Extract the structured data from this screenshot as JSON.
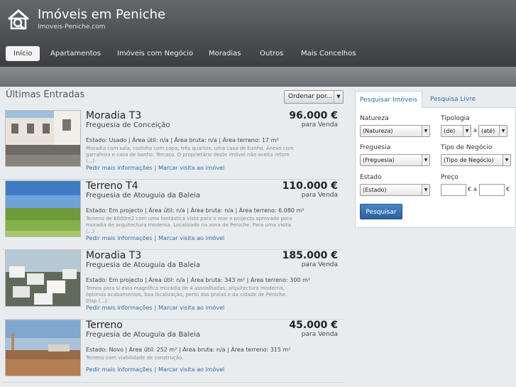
{
  "site": {
    "title": "Imóveis em Peniche",
    "subtitle": "Imoveis-Peniche.com",
    "logo_icon": "house-magnifier-icon"
  },
  "nav": {
    "items": [
      {
        "label": "Início",
        "active": true
      },
      {
        "label": "Apartamentos"
      },
      {
        "label": "Imóveis com Negócio"
      },
      {
        "label": "Moradias"
      },
      {
        "label": "Outros"
      },
      {
        "label": "Mais Concelhos"
      }
    ]
  },
  "listings_header": {
    "title": "Últimas Entradas",
    "order_label": "Ordenar por..."
  },
  "listings": [
    {
      "type": "Moradia  T3",
      "parish": "Freguesia de Conceição",
      "price": "96.000 €",
      "deal": "para Venda",
      "specs": "Estado: Usado  | Área útil: n/a  | Área bruta: n/a  | Área terreno: 17 m²",
      "description": "Moradia com sala, cozinha com copa, três quartos, uma casa de banho. Anexo com garrafeira e casa de banho. Terraço. O proprietário deste imóvel não aceita retom (...)",
      "link_info": "Pedir mais informações",
      "link_visit": "Marcar visita ao imóvel"
    },
    {
      "type": "Terreno  T4",
      "parish": "Freguesia de Atouguia da Baleia",
      "price": "110.000 €",
      "deal": "para Venda",
      "specs": "Estado: Em projecto  | Área útil: n/a  | Área bruta: n/a  | Área terreno: 6.080 m²",
      "description": "Terreno de 6000m2 com uma fantástica vista para o mar e projecto aprovado para moradia de arquitectura moderna. Localizado na zona de Peniche. Para uma visita (...)",
      "link_info": "Pedir mais informações",
      "link_visit": "Marcar visita ao imóvel"
    },
    {
      "type": "Moradia  T3",
      "parish": "Freguesia de Atouguia da Baleia",
      "price": "185.000 €",
      "deal": "para Venda",
      "specs": "Estado: Em projecto  | Área útil: n/a  | Área bruta: 343 m²  | Área terreno: 300 m²",
      "description": "Temos para si esta magnífica moradia de 4 assoalhadas, arquitectura moderna, óptimos acabamentos, boa localização, perto das praias e da cidade de Peniche. Disp (...)",
      "link_info": "Pedir mais informações",
      "link_visit": "Marcar visita ao imóvel"
    },
    {
      "type": "Terreno",
      "parish": "Freguesia de Atouguia da Baleia",
      "price": "45.000 €",
      "deal": "para Venda",
      "specs": "Estado: Novo  | Área útil: 252 m²  | Área bruta: n/a  | Área terreno: 315 m²",
      "description": "Terreno com viabilidade de construção.",
      "link_info": "Pedir mais informações",
      "link_visit": "Marcar visita ao imóvel"
    }
  ],
  "search": {
    "tab_main": "Pesquisar Imóveis",
    "tab_free": "Pesquisa Livre",
    "natureza_label": "Natureza",
    "natureza_value": "(Natureza)",
    "tipologia_label": "Tipologia",
    "tipologia_from": "(de)",
    "tipologia_a": "a",
    "tipologia_to": "(até)",
    "freguesia_label": "Freguesia",
    "freguesia_value": "(Freguesia)",
    "negocio_label": "Tipo de Negócio",
    "negocio_value": "(Tipo de Negócio)",
    "estado_label": "Estado",
    "estado_value": "(Estado)",
    "preco_label": "Preço",
    "preco_unit": "€",
    "preco_a": "a",
    "button": "Pesquisar"
  }
}
